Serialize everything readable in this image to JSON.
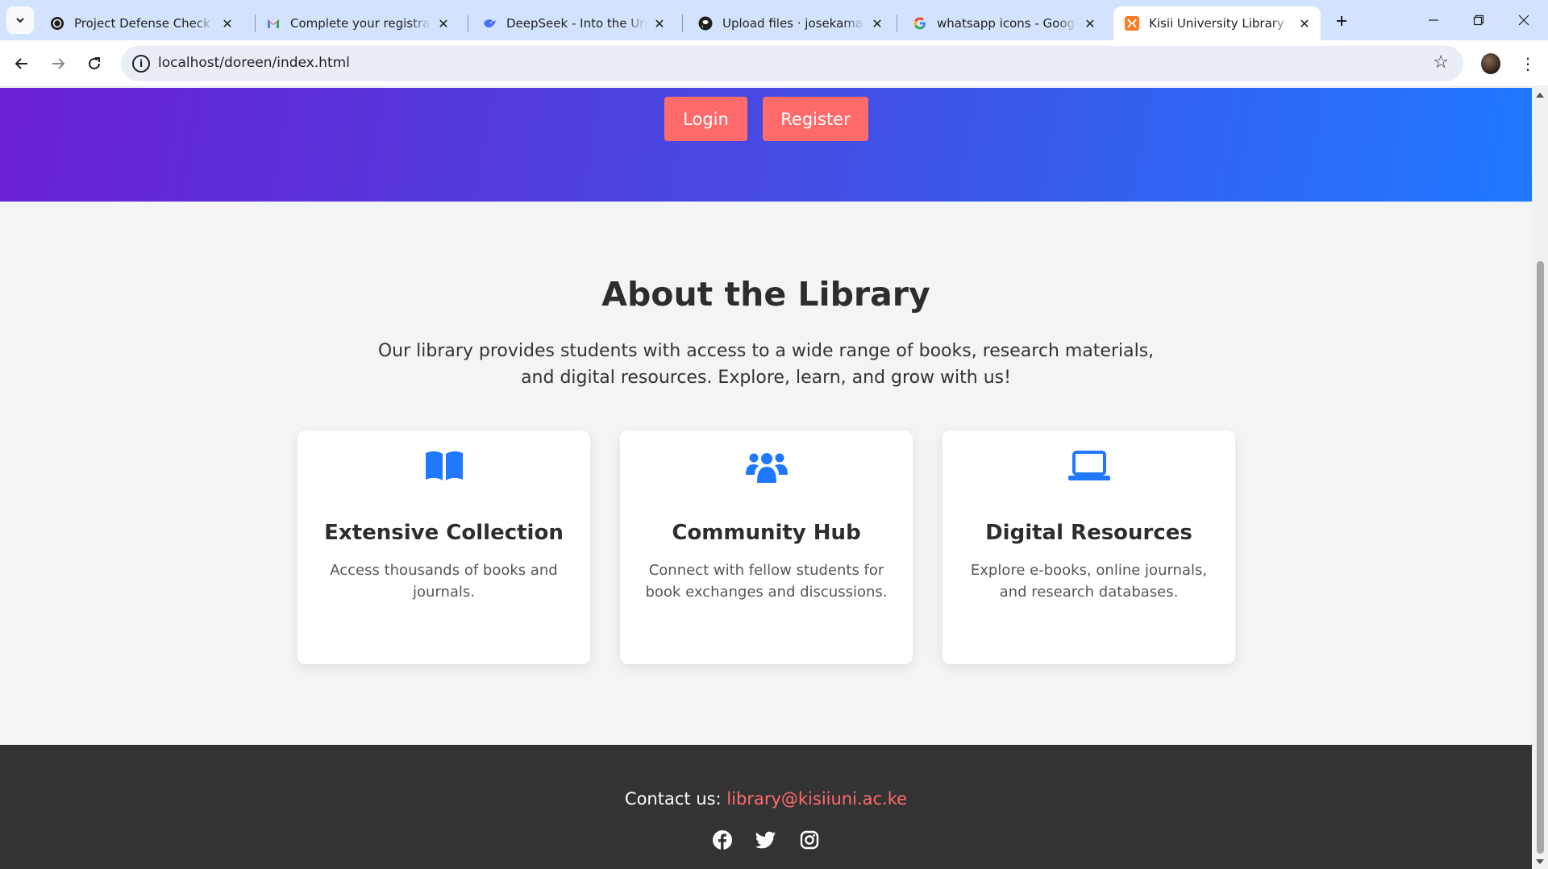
{
  "browser": {
    "tabs": [
      {
        "title": "Project Defense Check",
        "icon": "chatgpt-icon"
      },
      {
        "title": "Complete your registration",
        "icon": "gmail-icon"
      },
      {
        "title": "DeepSeek - Into the Unknown",
        "icon": "deepseek-icon"
      },
      {
        "title": "Upload files · josekamaa/p",
        "icon": "github-icon"
      },
      {
        "title": "whatsapp icons - Google Search",
        "icon": "google-icon"
      },
      {
        "title": "Kisii University Library",
        "icon": "xampp-icon",
        "active": true
      }
    ],
    "url": "localhost/doreen/index.html"
  },
  "hero": {
    "login_label": "Login",
    "register_label": "Register"
  },
  "about": {
    "title": "About the Library",
    "text": "Our library provides students with access to a wide range of books, research materials, and digital resources. Explore, learn, and grow with us!"
  },
  "features": [
    {
      "icon": "open-book-icon",
      "title": "Extensive Collection",
      "text": "Access thousands of books and journals."
    },
    {
      "icon": "users-icon",
      "title": "Community Hub",
      "text": "Connect with fellow students for book exchanges and discussions."
    },
    {
      "icon": "laptop-icon",
      "title": "Digital Resources",
      "text": "Explore e-books, online journals, and research databases."
    }
  ],
  "footer": {
    "contact_label": "Contact us:",
    "email": "library@kisiiuni.ac.ke",
    "socials": [
      "facebook-icon",
      "twitter-icon",
      "instagram-icon"
    ]
  },
  "colors": {
    "accent": "#ff6b6b",
    "icon_blue": "#1f78ff",
    "hero_start": "#6a1fd6",
    "hero_end": "#1f78ff",
    "footer_bg": "#333333"
  }
}
